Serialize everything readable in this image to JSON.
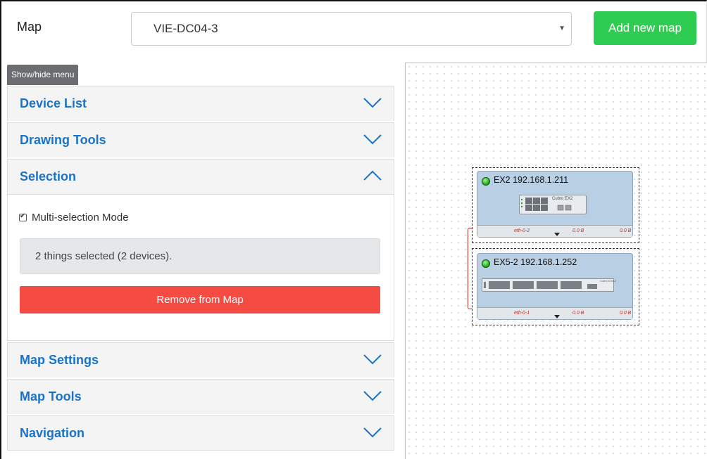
{
  "header": {
    "map_label": "Map",
    "selected_map": "VIE-DC04-3",
    "add_map_label": "Add new map"
  },
  "menu_toggle_label": "Show/hide menu",
  "panels": {
    "device_list": "Device List",
    "drawing_tools": "Drawing Tools",
    "selection": "Selection",
    "map_settings": "Map Settings",
    "map_tools": "Map Tools",
    "navigation": "Navigation"
  },
  "selection": {
    "multi_mode_label": "Multi-selection Mode",
    "multi_mode_checked": true,
    "status": "2 things selected (2 devices).",
    "remove_label": "Remove from Map"
  },
  "devices": [
    {
      "title": "EX2 192.168.1.211",
      "model": "Cubro EX2",
      "port": "eth-0-2",
      "rx": "0.0 B",
      "tx": "0.0 B",
      "status_color": "#22aa22"
    },
    {
      "title": "EX5-2 192.168.1.252",
      "model": "Cubro EX5-2",
      "port": "eth-0-1",
      "rx": "0.0 B",
      "tx": "0.0 B",
      "status_color": "#22aa22"
    }
  ],
  "colors": {
    "accent": "#1a73c8",
    "add_button": "#2fcc52",
    "remove_button": "#f44b43",
    "device_bg": "#b9cfe4",
    "link": "#a12828"
  }
}
